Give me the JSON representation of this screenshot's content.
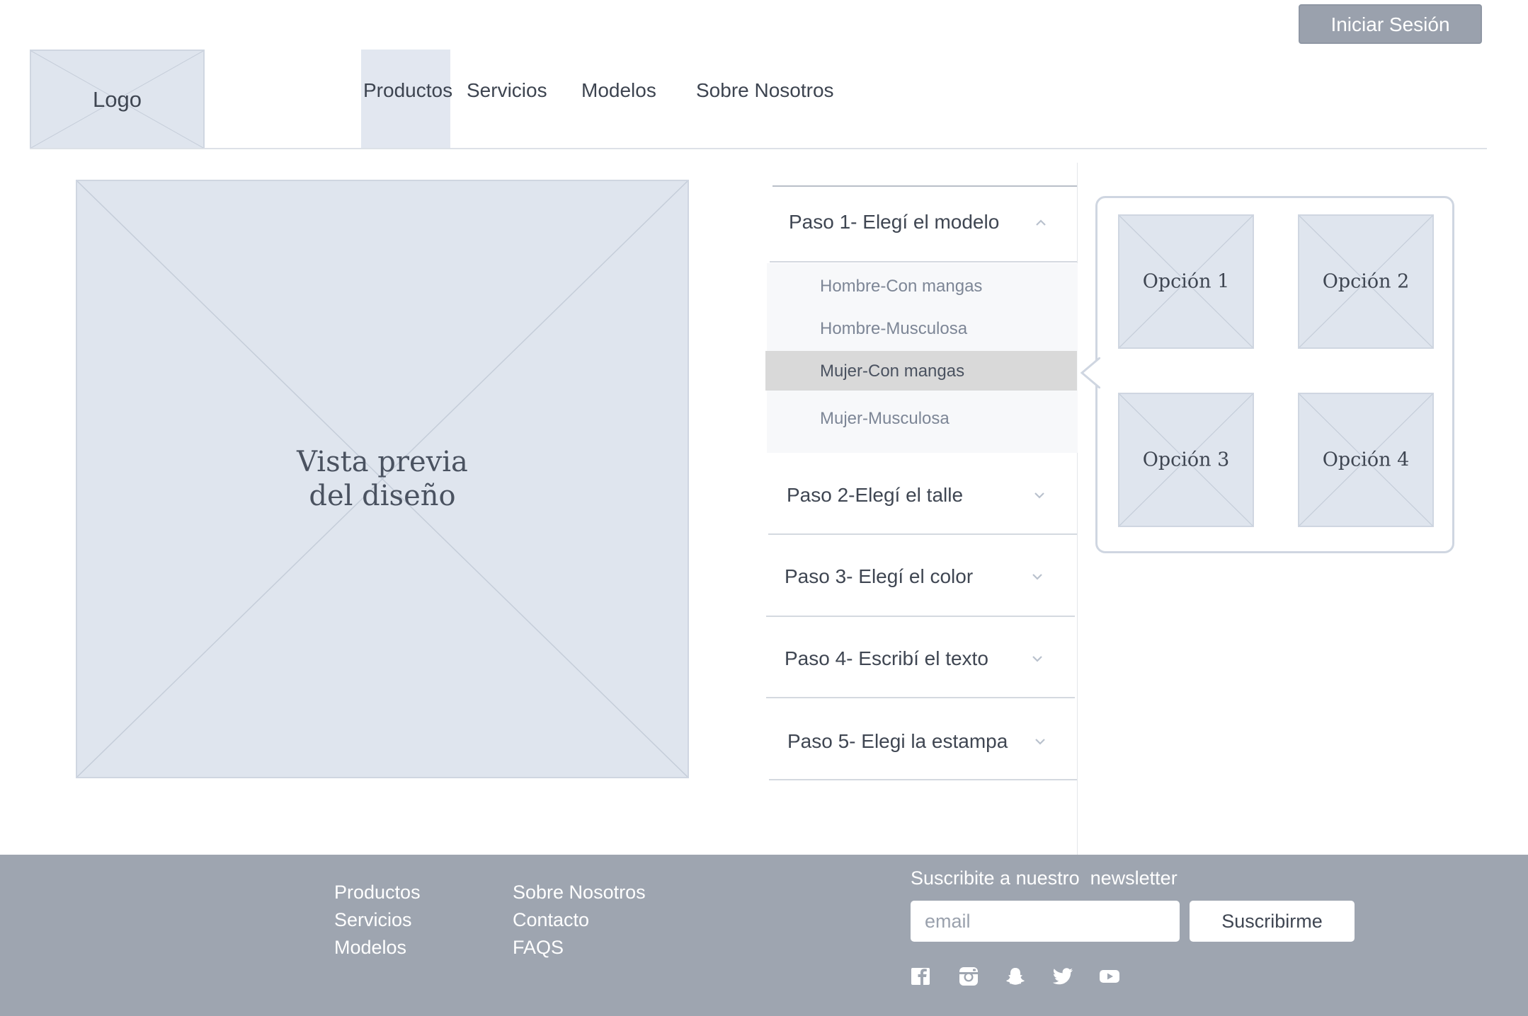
{
  "header": {
    "login_label": "Iniciar Sesión",
    "logo_label": "Logo",
    "nav": [
      "Productos",
      "Servicios",
      "Modelos",
      "Sobre Nosotros"
    ],
    "active_nav": "Productos"
  },
  "preview": {
    "line1": "Vista previa",
    "line2": "del diseño"
  },
  "steps": [
    {
      "label": "Paso 1- Elegí el modelo",
      "expanded": true,
      "icon": "chevron-up-icon"
    },
    {
      "label": "Paso 2-Elegí el talle",
      "expanded": false,
      "icon": "chevron-down-icon"
    },
    {
      "label": "Paso 3- Elegí el color",
      "expanded": false,
      "icon": "chevron-down-icon"
    },
    {
      "label": "Paso 4- Escribí el texto",
      "expanded": false,
      "icon": "chevron-down-icon"
    },
    {
      "label": "Paso 5- Elegi la estampa",
      "expanded": false,
      "icon": "chevron-down-icon"
    }
  ],
  "models": [
    "Hombre-Con mangas",
    "Hombre-Musculosa",
    "Mujer-Con mangas",
    "Mujer-Musculosa"
  ],
  "selected_model": "Mujer-Con mangas",
  "options": [
    "Opción 1",
    "Opción 2",
    "Opción 3",
    "Opción 4"
  ],
  "footer": {
    "col1": [
      "Productos",
      "Servicios",
      "Modelos"
    ],
    "col2": [
      "Sobre Nosotros",
      "Contacto",
      "FAQS"
    ],
    "newsletter_title": "Suscribite a nuestro  newsletter",
    "email_placeholder": "email",
    "subscribe_label": "Suscribirme",
    "social_icons": [
      "facebook-icon",
      "instagram-icon",
      "snapchat-icon",
      "twitter-icon",
      "youtube-icon"
    ]
  },
  "colors": {
    "placeholder_fill": "#dfe5ee",
    "footer_bg": "#9ea5b0",
    "button_gray": "#9aa1ad",
    "selected_row": "#d9d9d9"
  }
}
